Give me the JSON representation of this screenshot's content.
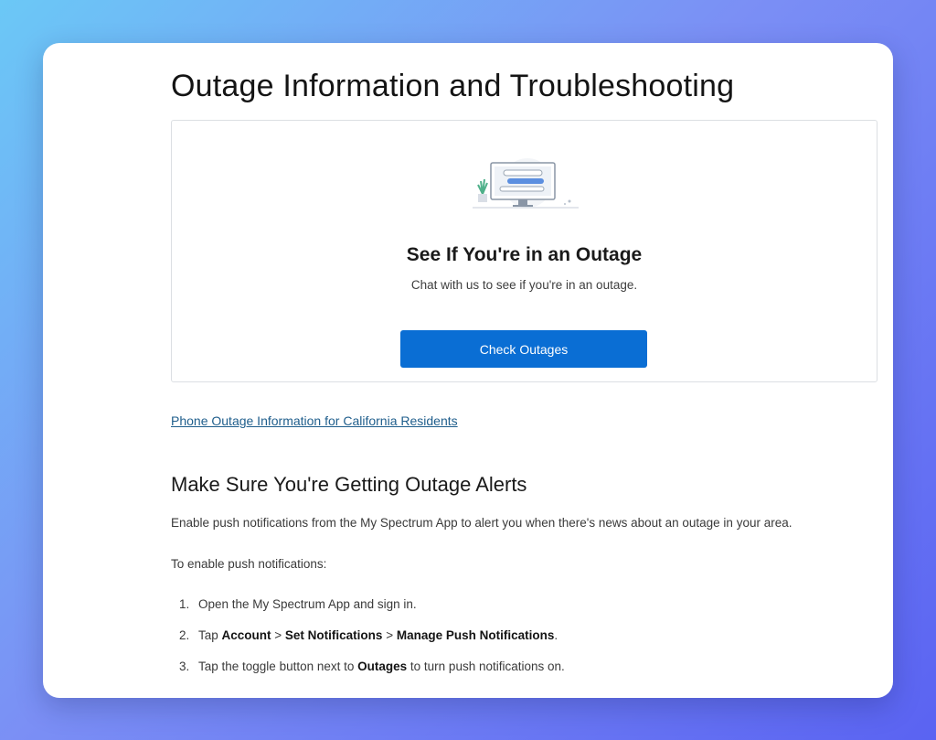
{
  "page": {
    "title": "Outage Information and Troubleshooting"
  },
  "outage_box": {
    "illustration_icon": "computer-chat-illustration",
    "heading": "See If You're in an Outage",
    "subtext": "Chat with us to see if you're in an outage.",
    "button_label": "Check Outages"
  },
  "ca_link": "Phone Outage Information for California Residents",
  "alerts": {
    "heading": "Make Sure You're Getting Outage Alerts",
    "intro": "Enable push notifications from the My Spectrum App to alert you when there's news about an outage in your area.",
    "enable_label": "To enable push notifications:",
    "steps": [
      {
        "num": "1.",
        "text": "Open the My Spectrum App and sign in."
      },
      {
        "num": "2.",
        "pre": "Tap ",
        "b1": "Account",
        "sep1": " > ",
        "b2": "Set Notifications",
        "sep2": " > ",
        "b3": "Manage Push Notifications",
        "post": "."
      },
      {
        "num": "3.",
        "pre": "Tap the toggle button next to ",
        "b1": "Outages",
        "post": " to turn push notifications on."
      }
    ]
  },
  "colors": {
    "accent": "#0a6ed4",
    "link": "#1f5e8c"
  }
}
